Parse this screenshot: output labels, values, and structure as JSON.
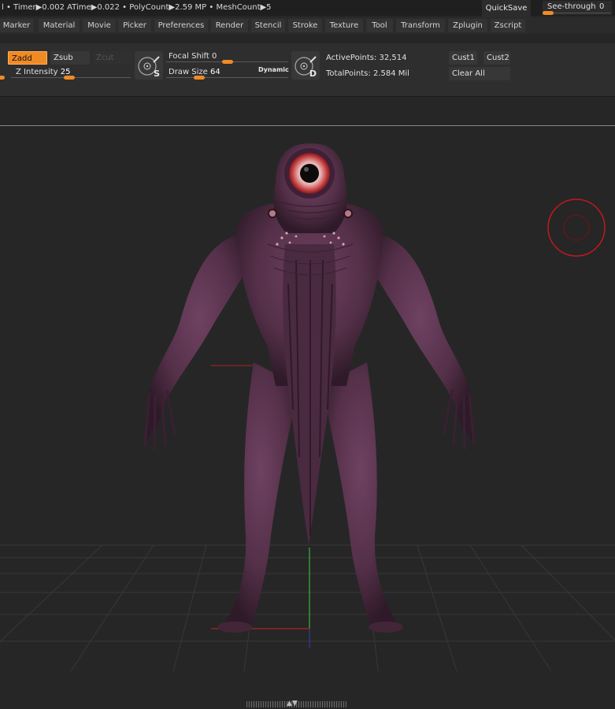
{
  "status": {
    "text": "l • Timer▶0.002 ATime▶0.022 • PolyCount▶2.59 MP • MeshCount▶5",
    "quicksave": "QuickSave",
    "see_through_label": "See-through",
    "see_through_value": "0",
    "see_through_level": 0
  },
  "menu": [
    "Marker",
    "Material",
    "Movie",
    "Picker",
    "Preferences",
    "Render",
    "Stencil",
    "Stroke",
    "Texture",
    "Tool",
    "Transform",
    "Zplugin",
    "Zscript"
  ],
  "toolbar": {
    "zadd": "Zadd",
    "zsub": "Zsub",
    "zcut": "Zcut",
    "z_intensity_label": "Z Intensity",
    "z_intensity_value": "25",
    "focal_shift_label": "Focal Shift",
    "focal_shift_value": "0",
    "draw_size_label": "Draw Size",
    "draw_size_value": "64",
    "dynamic": "Dynamic",
    "s_letter": "S",
    "d_letter": "D",
    "active_points": "ActivePoints: 32,514",
    "total_points": "TotalPoints: 2.584 Mil",
    "cust1": "Cust1",
    "cust2": "Cust2",
    "clear_all": "Clear All"
  },
  "colors": {
    "accent": "#f08a24",
    "creature": "#553049",
    "brush_cursor": "#c0191d"
  },
  "icons": {
    "stroke_icon": "s-stroke-icon",
    "alpha_icon": "d-alpha-icon",
    "expand_arrows": "up-down-arrow-icon"
  }
}
